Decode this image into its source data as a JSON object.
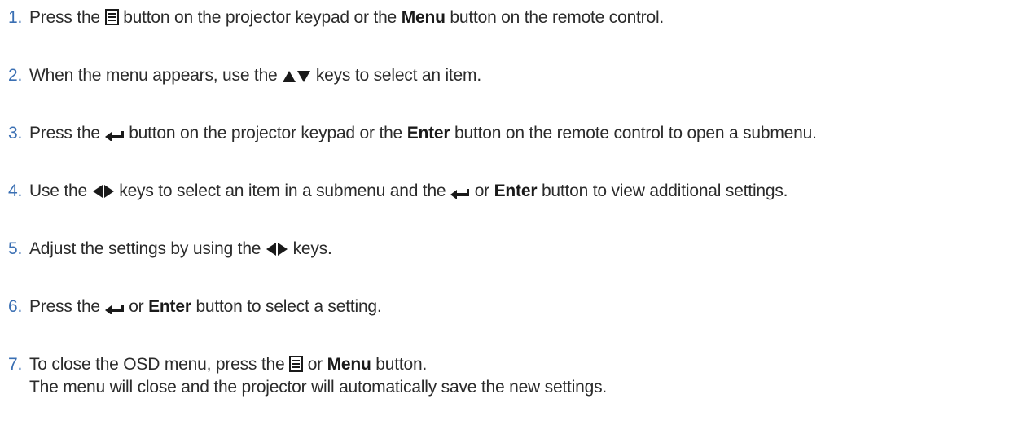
{
  "steps": [
    {
      "num": "1.",
      "a": "Press the",
      "b": "button on the projector keypad or the",
      "c": "Menu",
      "d": "button on the remote control."
    },
    {
      "num": "2.",
      "a": "When the menu appears, use the",
      "b": "keys to select an item."
    },
    {
      "num": "3.",
      "a": "Press the",
      "b": "button on the projector keypad or the",
      "c": "Enter",
      "d": "button on the remote control to open a submenu."
    },
    {
      "num": "4.",
      "a": "Use the",
      "b": "keys to select an item in a submenu and the",
      "c": "or",
      "d": "Enter",
      "e": "button to view additional settings."
    },
    {
      "num": "5.",
      "a": "Adjust the settings by using the",
      "b": "keys."
    },
    {
      "num": "6.",
      "a": "Press the",
      "b": "or",
      "c": "Enter",
      "d": "button to select a setting."
    },
    {
      "num": "7.",
      "a": "To close the OSD menu, press the",
      "b": "or",
      "c": "Menu",
      "d": "button.",
      "line2": "The menu will close and the projector will automatically save the new settings."
    }
  ],
  "icons": {
    "menu": "menu-icon",
    "updown": "up-down-arrow-icons",
    "enter": "enter-arrow-icon",
    "leftright": "left-right-arrow-icons"
  },
  "colors": {
    "step_number": "#3a6fb3",
    "text": "#2b2b2b",
    "icon": "#1a1a1a"
  }
}
